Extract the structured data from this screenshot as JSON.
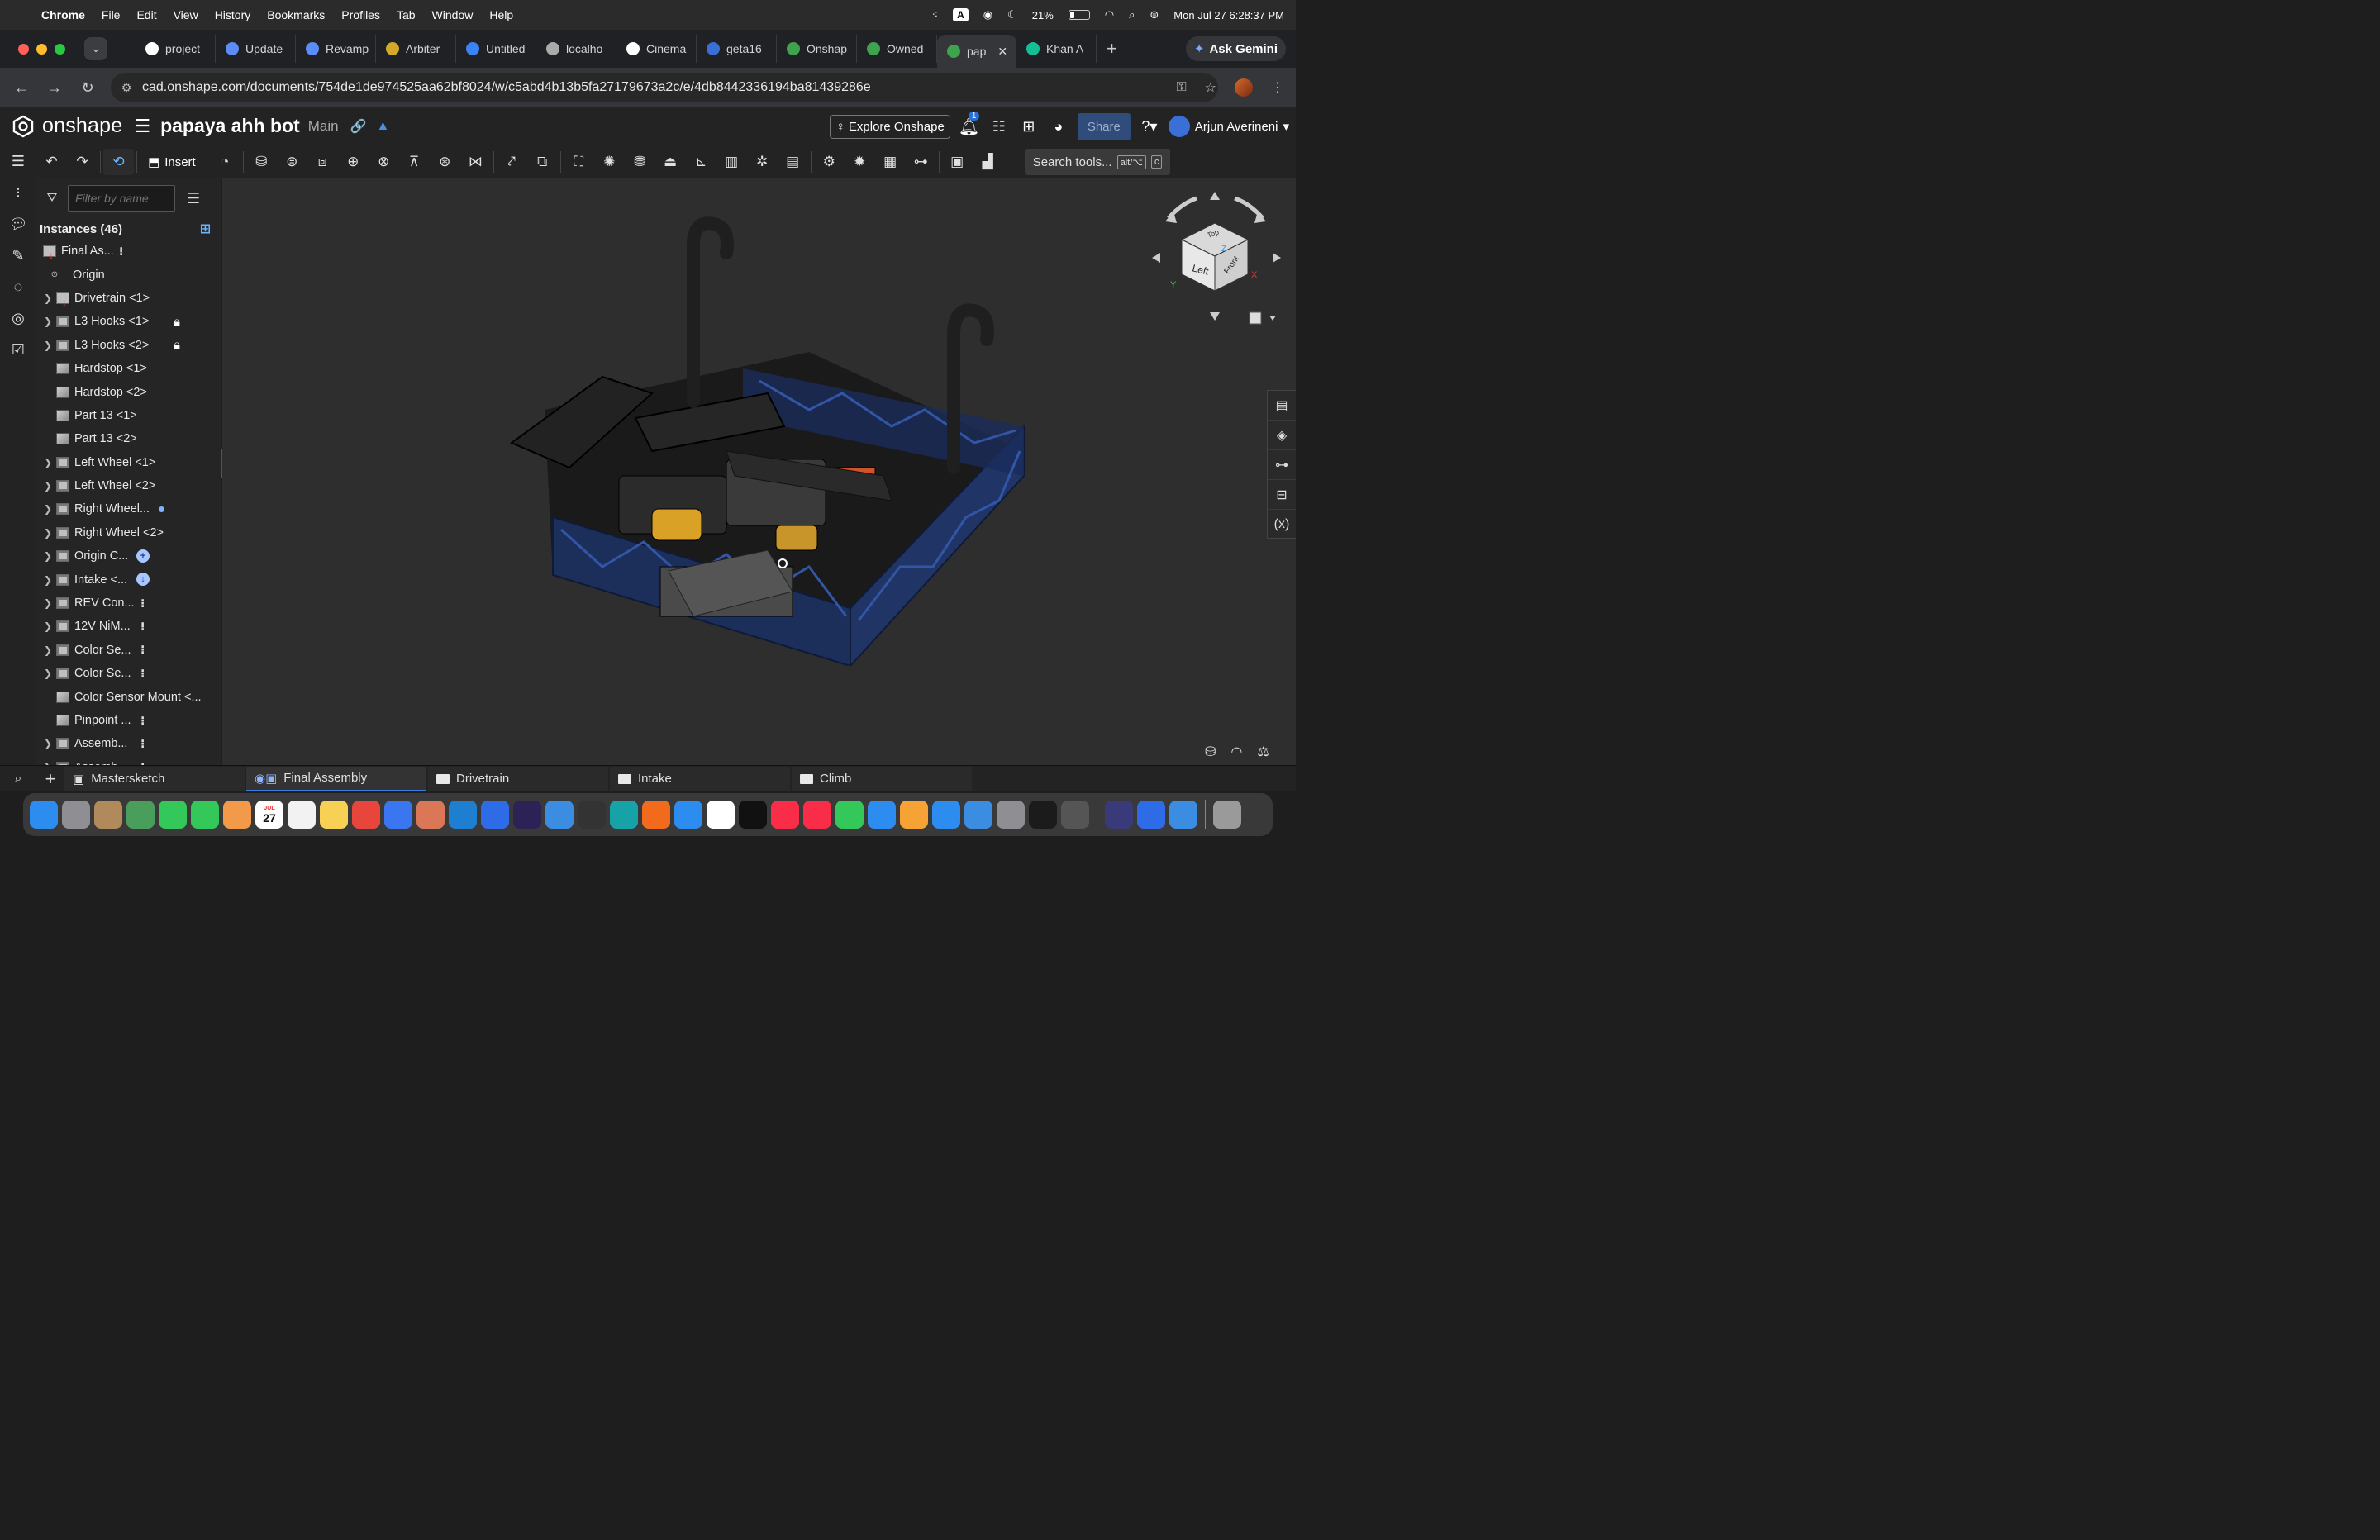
{
  "menubar": {
    "app": "Chrome",
    "items": [
      "File",
      "Edit",
      "View",
      "History",
      "Bookmarks",
      "Profiles",
      "Tab",
      "Window",
      "Help"
    ],
    "input_indicator": "A",
    "battery": "21%",
    "clock": "Mon Jul 27  6:28:37 PM"
  },
  "tabstrip": {
    "tabs": [
      {
        "label": "project",
        "icon": "github-icon",
        "color": "#ffffff"
      },
      {
        "label": "Update",
        "icon": "gemini-icon",
        "color": "#5b8cf7"
      },
      {
        "label": "Revamp",
        "icon": "gemini-icon",
        "color": "#5b8cf7"
      },
      {
        "label": "Arbiter",
        "icon": "arbiter-icon",
        "color": "#d4a92a"
      },
      {
        "label": "Untitled",
        "icon": "docs-icon",
        "color": "#3b82f6"
      },
      {
        "label": "localho",
        "icon": "globe-icon",
        "color": "#aaaaaa"
      },
      {
        "label": "Cinema",
        "icon": "openai-icon",
        "color": "#ffffff"
      },
      {
        "label": "geta16",
        "icon": "image-icon",
        "color": "#3b6fd8"
      },
      {
        "label": "Onshap",
        "icon": "onshape-icon",
        "color": "#3fa34d"
      },
      {
        "label": "Owned",
        "icon": "onshape-icon",
        "color": "#3fa34d"
      }
    ],
    "active_tab": {
      "label": "pap",
      "icon": "onshape-icon",
      "color": "#3fa34d"
    },
    "after_tab": {
      "label": "Khan A",
      "icon": "khan-icon",
      "color": "#14bf96"
    },
    "ask_gemini": "Ask Gemini"
  },
  "addressbar": {
    "url": "cad.onshape.com/documents/754de1de974525aa62bf8024/w/c5abd4b13b5fa27179673a2c/e/4db8442336194ba81439286e"
  },
  "onshape": {
    "brand": "onshape",
    "doc_name": "papaya ahh bot",
    "branch": "Main",
    "explore": "Explore Onshape",
    "notification_count": "1",
    "share": "Share",
    "user": "Arjun Averineni",
    "insert": "Insert",
    "search_tools": "Search tools...",
    "search_kbd_1": "alt/⌥",
    "search_kbd_2": "c"
  },
  "panel": {
    "filter_placeholder": "Filter by name",
    "instances_header": "Instances (46)",
    "root": "Final As...",
    "origin": "Origin",
    "rows": [
      {
        "label": "Drivetrain <1>",
        "chev": true,
        "icon": "assy-red",
        "trail": ""
      },
      {
        "label": "L3 Hooks <1>",
        "chev": true,
        "icon": "asm",
        "trail": "lock"
      },
      {
        "label": "L3 Hooks <2>",
        "chev": true,
        "icon": "asm",
        "trail": "lock"
      },
      {
        "label": "Hardstop <1>",
        "chev": false,
        "icon": "part",
        "trail": ""
      },
      {
        "label": "Hardstop <2>",
        "chev": false,
        "icon": "part",
        "trail": ""
      },
      {
        "label": "Part 13 <1>",
        "chev": false,
        "icon": "part",
        "trail": ""
      },
      {
        "label": "Part 13 <2>",
        "chev": false,
        "icon": "part",
        "trail": ""
      },
      {
        "label": "Left Wheel <1>",
        "chev": true,
        "icon": "asm",
        "trail": ""
      },
      {
        "label": "Left Wheel <2>",
        "chev": true,
        "icon": "asm",
        "trail": ""
      },
      {
        "label": "Right Wheel...",
        "chev": true,
        "icon": "asm",
        "trail": "dot"
      },
      {
        "label": "Right Wheel <2>",
        "chev": true,
        "icon": "asm",
        "trail": ""
      },
      {
        "label": "Origin C...",
        "chev": true,
        "icon": "asm",
        "trail": "circle"
      },
      {
        "label": "Intake <...",
        "chev": true,
        "icon": "asm",
        "trail": "circle-down"
      },
      {
        "label": "REV Con...",
        "chev": true,
        "icon": "asm",
        "trail": "vdots"
      },
      {
        "label": "12V NiM...",
        "chev": true,
        "icon": "asm",
        "trail": "vdots"
      },
      {
        "label": "Color Se...",
        "chev": true,
        "icon": "asm",
        "trail": "vdots"
      },
      {
        "label": "Color Se...",
        "chev": true,
        "icon": "asm",
        "trail": "vdots"
      },
      {
        "label": "Color Sensor Mount <...",
        "chev": false,
        "icon": "part",
        "trail": ""
      },
      {
        "label": "Pinpoint ...",
        "chev": false,
        "icon": "part",
        "trail": "vdots"
      },
      {
        "label": "Assemb...",
        "chev": true,
        "icon": "asm",
        "trail": "vdots"
      },
      {
        "label": "Assemb...",
        "chev": true,
        "icon": "asm",
        "trail": "vdots"
      }
    ]
  },
  "viewcube": {
    "top": "Top",
    "left": "Left",
    "front": "Front",
    "axis_x": "X",
    "axis_y": "Y",
    "axis_z": "Z"
  },
  "bottom_tabs": [
    {
      "label": "Mastersketch",
      "icon": "sketch-icon",
      "active": false
    },
    {
      "label": "Final Assembly",
      "icon": "assembly-icon",
      "active": true
    },
    {
      "label": "Drivetrain",
      "icon": "folder-icon",
      "active": false
    },
    {
      "label": "Intake",
      "icon": "folder-icon",
      "active": false
    },
    {
      "label": "Climb",
      "icon": "folder-icon",
      "active": false
    }
  ],
  "dock": {
    "calendar_month": "JUL",
    "calendar_day": "27",
    "apps": [
      {
        "name": "finder-icon",
        "color": "#2d8cf0"
      },
      {
        "name": "launchpad-icon",
        "color": "#8e8e93"
      },
      {
        "name": "contacts-icon",
        "color": "#b08a5a"
      },
      {
        "name": "maps-icon",
        "color": "#4a9e5c"
      },
      {
        "name": "facetime-icon",
        "color": "#34c759"
      },
      {
        "name": "messages-icon",
        "color": "#34c759"
      },
      {
        "name": "photos-icon",
        "color": "#f2994a"
      },
      {
        "name": "calendar-icon",
        "color": "#ffffff"
      },
      {
        "name": "reminders-icon",
        "color": "#f2f2f2"
      },
      {
        "name": "notes-icon",
        "color": "#f7d154"
      },
      {
        "name": "chrome-icon",
        "color": "#e8453c"
      },
      {
        "name": "signal-icon",
        "color": "#3a76f0"
      },
      {
        "name": "claude-icon",
        "color": "#d97757"
      },
      {
        "name": "vscode-icon",
        "color": "#1e7fd0"
      },
      {
        "name": "xcode-icon",
        "color": "#2e6be6"
      },
      {
        "name": "eclipse-icon",
        "color": "#2c2255"
      },
      {
        "name": "hammer-icon",
        "color": "#3a8de0"
      },
      {
        "name": "typora-icon",
        "color": "#333333"
      },
      {
        "name": "arduino-icon",
        "color": "#17a2a8"
      },
      {
        "name": "fusion-icon",
        "color": "#f26b1d"
      },
      {
        "name": "safari-icon",
        "color": "#2d8cf0"
      },
      {
        "name": "freeform-icon",
        "color": "#ffffff"
      },
      {
        "name": "appletv-icon",
        "color": "#111111"
      },
      {
        "name": "music-icon",
        "color": "#fa2d48"
      },
      {
        "name": "news-icon",
        "color": "#fa2d48"
      },
      {
        "name": "numbers-icon",
        "color": "#34c759"
      },
      {
        "name": "keynote-icon",
        "color": "#2d8cf0"
      },
      {
        "name": "pages-icon",
        "color": "#f7a234"
      },
      {
        "name": "appstore-icon",
        "color": "#2d8cf0"
      },
      {
        "name": "mail-icon",
        "color": "#3a8de0"
      },
      {
        "name": "settings-icon",
        "color": "#8e8e93"
      },
      {
        "name": "terminal-icon",
        "color": "#1b1b1b"
      },
      {
        "name": "iphone-mirror-icon",
        "color": "#555555"
      },
      {
        "name": "arc-icon",
        "color": "#3a3a7a"
      },
      {
        "name": "xcode2-icon",
        "color": "#2e6be6"
      },
      {
        "name": "quicktime-icon",
        "color": "#3a8de0"
      },
      {
        "name": "trash-icon",
        "color": "#9a9a9a"
      }
    ]
  }
}
